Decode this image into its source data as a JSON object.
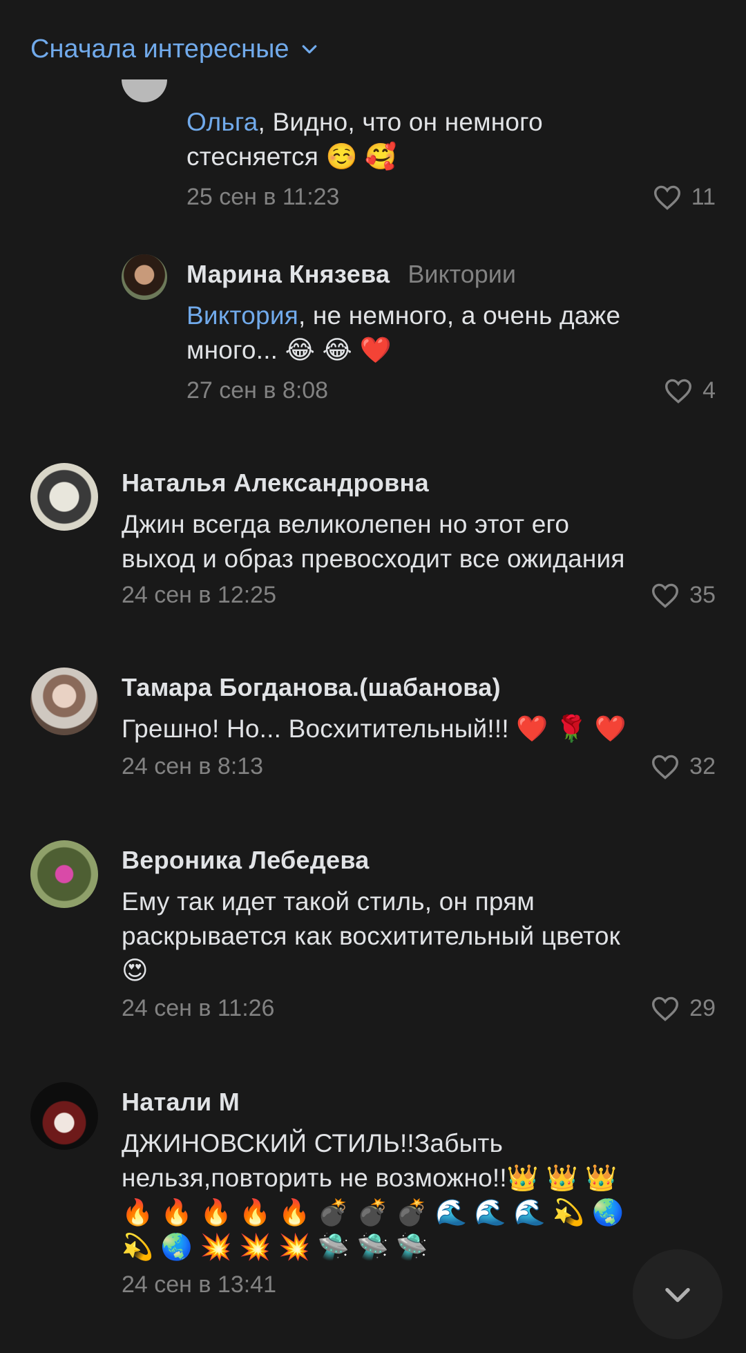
{
  "sort": {
    "label": "Сначала интересные"
  },
  "comments": [
    {
      "mention": "Ольга",
      "text_rest": ", Видно, что он немного",
      "text_line2": "стесняется ☺️ 🥰",
      "date": "25 сен в 11:23",
      "likes": "11"
    },
    {
      "author": "Марина Князева",
      "reply_to": "Виктории",
      "mention": "Виктория",
      "text_rest": ", не немного, а очень даже",
      "text_line2": "много... 😂 😂 ❤️",
      "date": "27 сен в 8:08",
      "likes": "4"
    },
    {
      "author": "Наталья Александровна",
      "text_line1": "Джин всегда великолепен но этот его",
      "text_line2": "выход и образ превосходит все ожидания",
      "date": "24 сен в 12:25",
      "likes": "35"
    },
    {
      "author": "Тамара Богданова.(шабанова)",
      "text_line1": "Грешно! Но... Восхитительный!!! ❤️ 🌹 ❤️",
      "date": "24 сен в 8:13",
      "likes": "32"
    },
    {
      "author": "Вероника Лебедева",
      "text_line1": "Ему так идет такой стиль, он прям",
      "text_line2": "раскрывается как восхитительный цветок",
      "text_line3": "😍",
      "date": "24 сен в 11:26",
      "likes": "29"
    },
    {
      "author": "Натали М",
      "text_line1": "ДЖИНОВСКИЙ СТИЛЬ!!Забыть",
      "text_line2": "нельзя,повторить не возможно!!👑 👑 👑",
      "text_line3": "🔥 🔥 🔥 🔥 🔥 💣 💣 💣 🌊 🌊 🌊 💫 🌏",
      "text_line4": "💫 🌏 💥 💥 💥 🛸 🛸 🛸",
      "date": "24 сен в 13:41"
    }
  ],
  "icons": {
    "sort": "chevron-down-icon",
    "like": "heart-outline-icon",
    "scroll": "chevron-down-icon"
  },
  "colors": {
    "background": "#191919",
    "accent": "#71aaeb",
    "secondary_text": "#828282",
    "primary_text": "#e1e3e6"
  }
}
